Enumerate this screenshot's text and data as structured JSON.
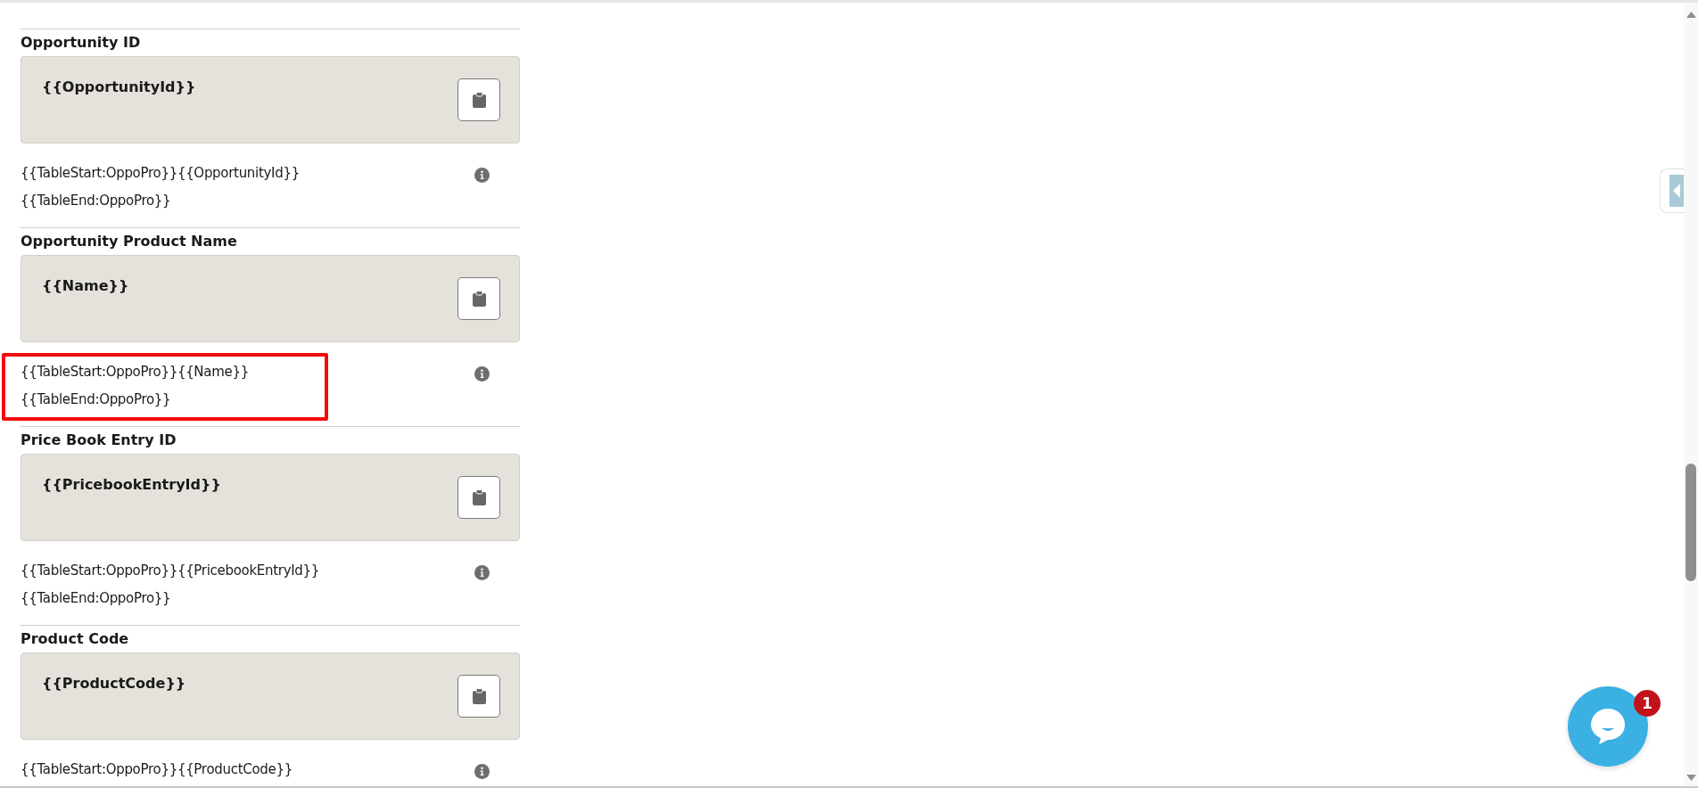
{
  "sections": [
    {
      "title": "Opportunity ID",
      "token": "{{OpportunityId}}",
      "code_lines": [
        "{{TableStart:OppoPro}}{{OpportunityId}}",
        "{{TableEnd:OppoPro}}"
      ],
      "highlighted": false
    },
    {
      "title": "Opportunity Product Name",
      "token": "{{Name}}",
      "code_lines": [
        "{{TableStart:OppoPro}}{{Name}}",
        "{{TableEnd:OppoPro}}"
      ],
      "highlighted": true
    },
    {
      "title": "Price Book Entry ID",
      "token": "{{PricebookEntryId}}",
      "code_lines": [
        "{{TableStart:OppoPro}}{{PricebookEntryId}}",
        "{{TableEnd:OppoPro}}"
      ],
      "highlighted": false
    },
    {
      "title": "Product Code",
      "token": "{{ProductCode}}",
      "code_lines": [
        "{{TableStart:OppoPro}}{{ProductCode}}"
      ],
      "highlighted": false
    }
  ],
  "chat": {
    "badge": "1"
  }
}
